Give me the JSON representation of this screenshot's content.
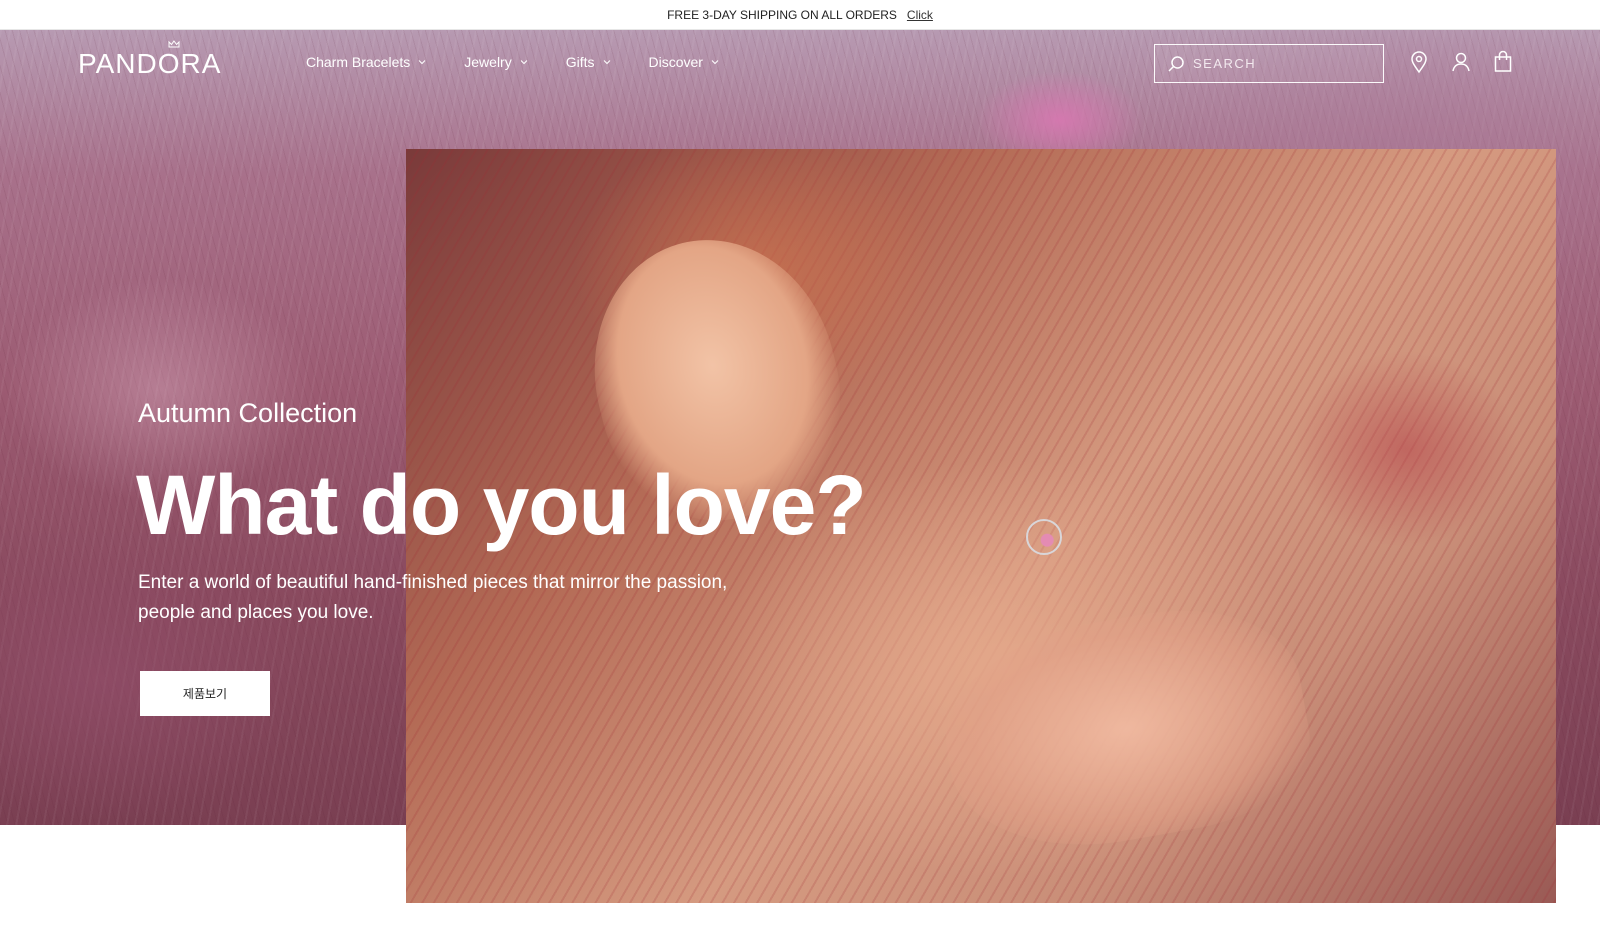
{
  "announcement": {
    "text": "FREE 3-DAY SHIPPING ON ALL ORDERS",
    "link_label": "Click"
  },
  "header": {
    "logo_text": "PANDORA",
    "nav": [
      {
        "label": "Charm Bracelets"
      },
      {
        "label": "Jewelry"
      },
      {
        "label": "Gifts"
      },
      {
        "label": "Discover"
      }
    ],
    "search": {
      "placeholder": "SEARCH"
    },
    "icons": [
      "location-pin-icon",
      "account-icon",
      "shopping-bag-icon"
    ]
  },
  "hero": {
    "eyebrow": "Autumn Collection",
    "title": "What do you love?",
    "subtitle": "Enter a world of beautiful hand-finished pieces that mirror the passion, people and places you love.",
    "cta_label": "제품보기"
  },
  "colors": {
    "hero_text": "#ffffff",
    "cta_background": "#ffffff",
    "announcement_background": "#ffffff"
  }
}
